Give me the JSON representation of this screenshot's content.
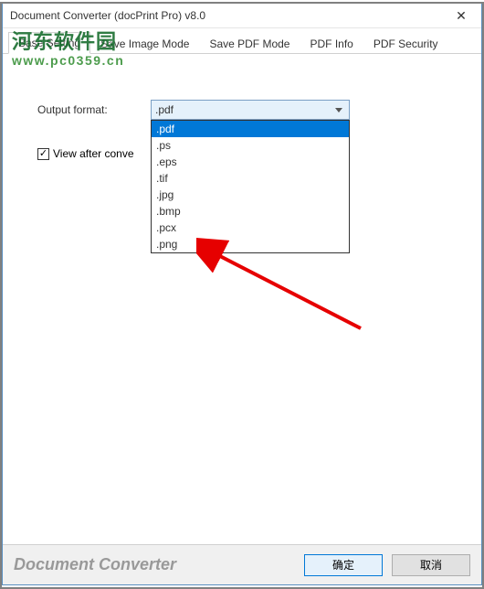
{
  "window": {
    "title": "Document Converter (docPrint Pro) v8.0"
  },
  "tabs": {
    "items": [
      {
        "label": "Base Setting",
        "active": true
      },
      {
        "label": "Save Image Mode",
        "active": false
      },
      {
        "label": "Save PDF Mode",
        "active": false
      },
      {
        "label": "PDF Info",
        "active": false
      },
      {
        "label": "PDF Security",
        "active": false
      }
    ]
  },
  "content": {
    "output_format_label": "Output format:",
    "output_format_value": ".pdf",
    "view_after_convert_label": "View after conve",
    "view_after_convert_checked": true
  },
  "dropdown": {
    "options": [
      ".pdf",
      ".ps",
      ".eps",
      ".tif",
      ".jpg",
      ".bmp",
      ".pcx",
      ".png"
    ],
    "selected_index": 0
  },
  "bottom": {
    "brand": "Document Converter",
    "ok": "确定",
    "cancel": "取消"
  },
  "watermark": {
    "line1": "河东软件园",
    "line2": "www.pc0359.cn"
  },
  "colors": {
    "selection": "#0078d7",
    "window_border": "#5a8fc0",
    "arrow": "#e60000"
  }
}
